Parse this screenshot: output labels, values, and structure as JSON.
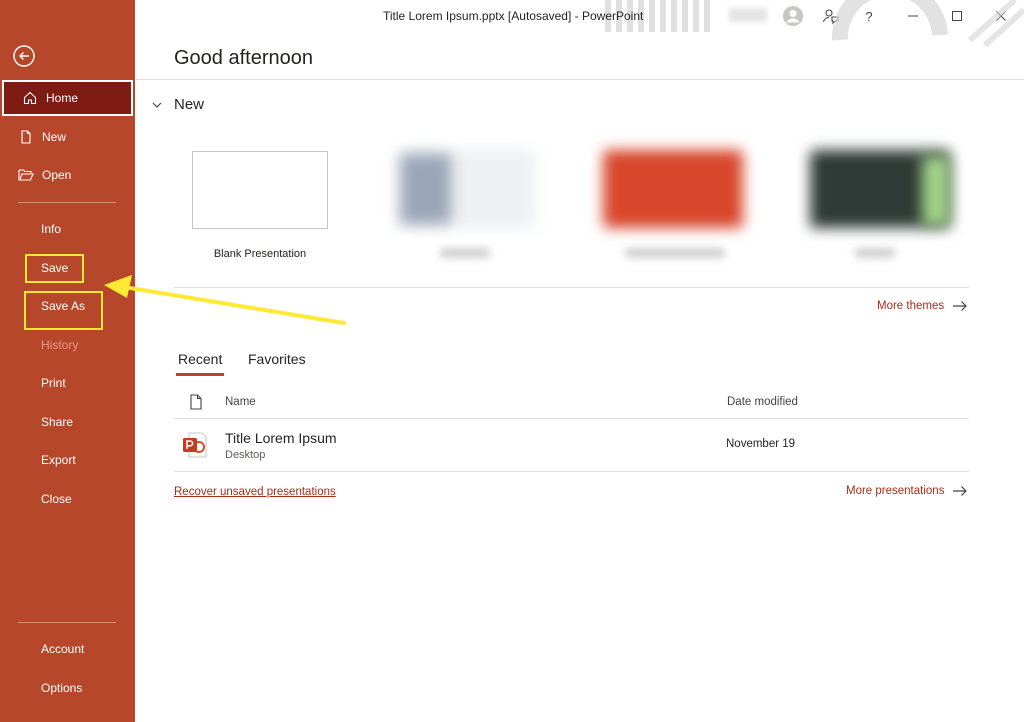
{
  "window": {
    "title": "Title Lorem Ipsum.pptx [Autosaved]  -  PowerPoint",
    "help_label": "?"
  },
  "sidebar": {
    "items": [
      {
        "label": "Home",
        "icon": "home-icon"
      },
      {
        "label": "New",
        "icon": "new-doc-icon"
      },
      {
        "label": "Open",
        "icon": "folder-open-icon"
      },
      {
        "label": "Info"
      },
      {
        "label": "Save"
      },
      {
        "label": "Save As"
      },
      {
        "label": "History"
      },
      {
        "label": "Print"
      },
      {
        "label": "Share"
      },
      {
        "label": "Export"
      },
      {
        "label": "Close"
      },
      {
        "label": "Account"
      },
      {
        "label": "Options"
      }
    ]
  },
  "main": {
    "greeting": "Good afternoon",
    "new_section": {
      "heading": "New",
      "blank_label": "Blank Presentation",
      "more_themes": "More themes"
    },
    "tabs": [
      {
        "label": "Recent"
      },
      {
        "label": "Favorites"
      }
    ],
    "list": {
      "col_name": "Name",
      "col_date": "Date modified",
      "files": [
        {
          "name": "Title Lorem Ipsum",
          "location": "Desktop",
          "modified": "November 19"
        }
      ]
    },
    "recover_link": "Recover unsaved presentations",
    "more_presentations": "More presentations"
  },
  "colors": {
    "accent": "#b7472a",
    "active_nav": "#7e1b13",
    "highlight": "#ffe933",
    "link": "#a92b1a"
  }
}
